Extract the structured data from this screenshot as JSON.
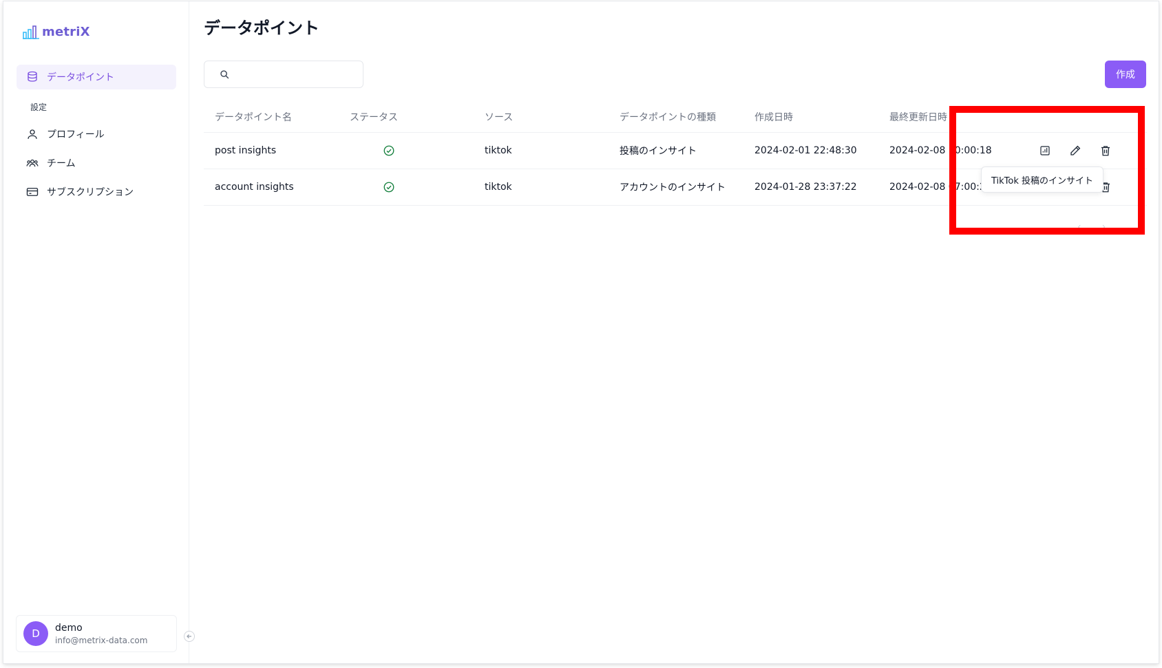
{
  "app": {
    "logo_text": "metriX"
  },
  "sidebar": {
    "nav_active": "データポイント",
    "section_label": "設定",
    "items": [
      {
        "label": "プロフィール",
        "icon": "user-icon"
      },
      {
        "label": "チーム",
        "icon": "team-icon"
      },
      {
        "label": "サブスクリプション",
        "icon": "credit-card-icon"
      }
    ]
  },
  "user": {
    "initial": "D",
    "name": "demo",
    "email": "info@metrix-data.com"
  },
  "main": {
    "title": "データポイント",
    "search_placeholder": "",
    "create_label": "作成"
  },
  "table": {
    "headers": [
      "データポイント名",
      "ステータス",
      "ソース",
      "データポイントの種類",
      "作成日時",
      "最終更新日時"
    ],
    "rows": [
      {
        "name": "post insights",
        "status": "active",
        "source": "tiktok",
        "type": "投稿のインサイト",
        "created": "2024-02-01 22:48:30",
        "updated": "2024-02-08 10:00:18"
      },
      {
        "name": "account insights",
        "status": "active",
        "source": "tiktok",
        "type": "アカウントのインサイト",
        "created": "2024-01-28 23:37:22",
        "updated": "2024-02-08 07:00:22"
      }
    ]
  },
  "tooltip": {
    "text": "TikTok 投稿のインサイト"
  },
  "colors": {
    "accent": "#8b5cf6",
    "status_ok": "#15803d",
    "highlight": "#ff0000"
  }
}
